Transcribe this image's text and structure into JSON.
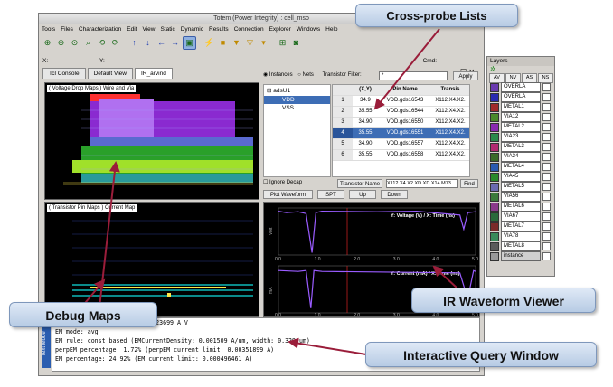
{
  "window_title": "Totem (Power Integrity) : cell_mso",
  "menu": [
    "Tools",
    "Files",
    "Characterization",
    "Edit",
    "View",
    "Static",
    "Dynamic",
    "Results",
    "Connection",
    "Explorer",
    "Windows",
    "Help"
  ],
  "toolbar_icons": [
    "zoom-in-icon",
    "zoom-out-icon",
    "zoom-fit-icon",
    "zoom-area-icon",
    "zoom-previous-icon",
    "refresh-icon",
    "pan-up-icon",
    "pan-down-icon",
    "pan-left-icon",
    "pan-right-icon",
    "select-icon",
    "probe-icon",
    "highlight-icon",
    "filter-icon",
    "filter-clear-icon",
    "filter-add-icon",
    "zoom-selection-icon",
    "camera-icon"
  ],
  "xy_row": {
    "x_label": "X:",
    "y_label": "Y:",
    "cmd_label": "Cmd:"
  },
  "tabs": [
    "Tcl Console",
    "Default View",
    "IR_arvind"
  ],
  "panels": {
    "top_map_label": "( Voltage Drop Maps ) Wire and Via",
    "bottom_map_label": "( Transistor Pin Maps ) Current Map"
  },
  "net_selector": {
    "instances": "Instances",
    "nets": "Nets",
    "filter_label": "Transistor Filter:",
    "filter_value": "*",
    "apply": "Apply"
  },
  "tree": {
    "root": "adsU1",
    "children": [
      "VDD",
      "VSS"
    ]
  },
  "grid": {
    "columns": [
      "(X,Y)",
      "Pin Name",
      "Transis"
    ],
    "rows": [
      {
        "n": "1",
        "xy": "34.9",
        "pin": "VDD.gds16543",
        "tr": "X112.X4.X2."
      },
      {
        "n": "2",
        "xy": "35.55",
        "pin": "VDD.gds16544",
        "tr": "X112.X4.X2."
      },
      {
        "n": "3",
        "xy": "34.90",
        "pin": "VDD.gds16550",
        "tr": "X112.X4.X2."
      },
      {
        "n": "4",
        "xy": "35.55",
        "pin": "VDD.gds16551",
        "tr": "X112.X4.X2."
      },
      {
        "n": "5",
        "xy": "34.90",
        "pin": "VDD.gds16557",
        "tr": "X112.X4.X2."
      },
      {
        "n": "6",
        "xy": "35.55",
        "pin": "VDD.gds16558",
        "tr": "X112.X4.X2."
      }
    ]
  },
  "ignore_decap": "Ignore Decap",
  "transistor_name": {
    "label": "Transistor Name",
    "value": "X112.X4.X2.XD.XD.X14.M73",
    "find": "Find"
  },
  "buttons": {
    "plot_waveform": "Plot Waveform",
    "spt": "SPT",
    "up": "Up",
    "down": "Down"
  },
  "waveform": {
    "top_caption": "Y: Voltage (V) / X: Time (ns)",
    "bottom_caption": "Y: Current (mA) / X: Time (ns)",
    "top_ylabel": "Volt",
    "bottom_ylabel": "mA",
    "x_ticks": [
      "0.0",
      "1.0",
      "2.0",
      "3.0",
      "4.0",
      "5.0"
    ],
    "top_curve": [
      [
        0,
        0.93
      ],
      [
        0.2,
        0.9
      ],
      [
        0.5,
        0.92
      ],
      [
        0.7,
        0.88
      ],
      [
        0.85,
        0.05
      ],
      [
        0.95,
        0.9
      ],
      [
        1.1,
        0.93
      ],
      [
        2.5,
        0.92
      ],
      [
        3.5,
        0.93
      ],
      [
        4.6,
        0.85
      ],
      [
        4.7,
        0.55
      ],
      [
        4.8,
        0.9
      ],
      [
        5.0,
        0.92
      ]
    ],
    "bottom_curve": [
      [
        0,
        0.9
      ],
      [
        0.5,
        0.88
      ],
      [
        0.7,
        0.9
      ],
      [
        0.82,
        0.1
      ],
      [
        0.9,
        0.9
      ],
      [
        1.1,
        0.88
      ],
      [
        4.6,
        0.85
      ],
      [
        4.8,
        0.3
      ],
      [
        4.95,
        0.9
      ],
      [
        5.0,
        0.88
      ]
    ]
  },
  "layers": {
    "title": "Layers",
    "tabs": [
      "AV",
      "NV",
      "AS",
      "NS"
    ],
    "items": [
      {
        "name": "OVERLA",
        "color": "#6a3ab0"
      },
      {
        "name": "OVERLA",
        "color": "#2a2ab0"
      },
      {
        "name": "METAL1",
        "color": "#a02a2a"
      },
      {
        "name": "VIA12",
        "color": "#4a8a2a"
      },
      {
        "name": "METAL2",
        "color": "#8a2ab0"
      },
      {
        "name": "VIA23",
        "color": "#2a8a4a"
      },
      {
        "name": "METAL3",
        "color": "#b02a70"
      },
      {
        "name": "VIA34",
        "color": "#3a6a2a"
      },
      {
        "name": "METAL4",
        "color": "#2a5ab0"
      },
      {
        "name": "VIA45",
        "color": "#2a8a2a"
      },
      {
        "name": "METAL5",
        "color": "#6a6ab0"
      },
      {
        "name": "VIA56",
        "color": "#3a7a3a"
      },
      {
        "name": "METAL6",
        "color": "#8a3a8a"
      },
      {
        "name": "VIA67",
        "color": "#2a6a3a"
      },
      {
        "name": "METAL7",
        "color": "#7a2a2a"
      },
      {
        "name": "VIA78",
        "color": "#3a8a5a"
      },
      {
        "name": "METAL8",
        "color": "#5a5a5a"
      },
      {
        "name": "instance",
        "color": "#999999"
      }
    ]
  },
  "console": {
    "tab": "Text Mode",
    "lines": [
      "   at query position: 0.000123699 A V",
      "EM mode: avg",
      "EM rule: const based (EMCurrentDensity: 0.001509 A/um, width: 0.329 um)",
      "perpEM percentage: 1.72% (perpEM current limit: 0.00351899 A)",
      "EM percentage: 24.92% (EM current limit: 0.000496461 A)"
    ]
  },
  "callouts": {
    "cross_probe": "Cross-probe Lists",
    "debug_maps": "Debug Maps",
    "ir_waveform": "IR Waveform Viewer",
    "query_window": "Interactive Query Window"
  },
  "colors": {
    "accent": "#3d6db5",
    "arrow": "#9a1d3a",
    "callout_bg": "#c9d8ec"
  }
}
